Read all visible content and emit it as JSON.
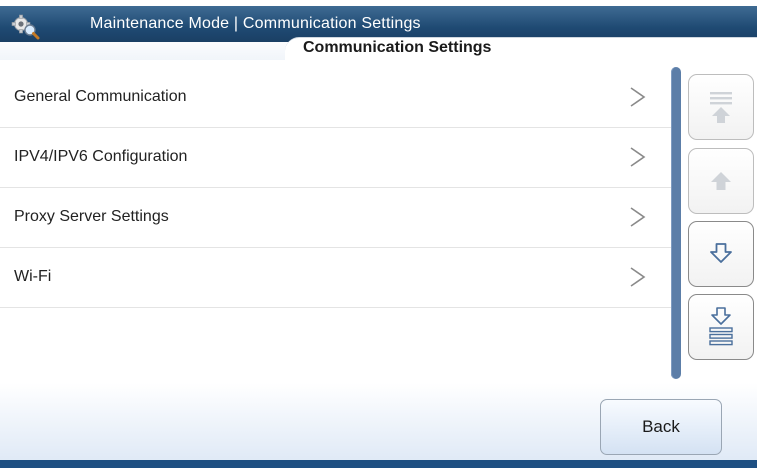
{
  "header": {
    "title": "Maintenance Mode | Communication Settings",
    "tab_label": "Communication Settings",
    "icon": "gear-magnifier-icon"
  },
  "menu": {
    "items": [
      {
        "label": "General Communication",
        "chevron": ">"
      },
      {
        "label": "IPV4/IPV6 Configuration",
        "chevron": ">"
      },
      {
        "label": "Proxy Server Settings",
        "chevron": ">"
      },
      {
        "label": "Wi-Fi",
        "chevron": ">"
      }
    ]
  },
  "scroll": {
    "buttons": [
      {
        "name": "scroll-to-top",
        "icon": "arrow-up-to-top-icon",
        "enabled": false
      },
      {
        "name": "scroll-up",
        "icon": "arrow-up-icon",
        "enabled": false
      },
      {
        "name": "scroll-down",
        "icon": "arrow-down-icon",
        "enabled": true
      },
      {
        "name": "scroll-to-bottom",
        "icon": "arrow-down-to-bottom-icon",
        "enabled": true
      }
    ]
  },
  "footer": {
    "back_label": "Back"
  },
  "colors": {
    "title_bar": "#1f4a73",
    "scroll_track": "#5c7ea8",
    "arrow_active": "#4a6f9c",
    "arrow_disabled": "#c8ccd2"
  }
}
